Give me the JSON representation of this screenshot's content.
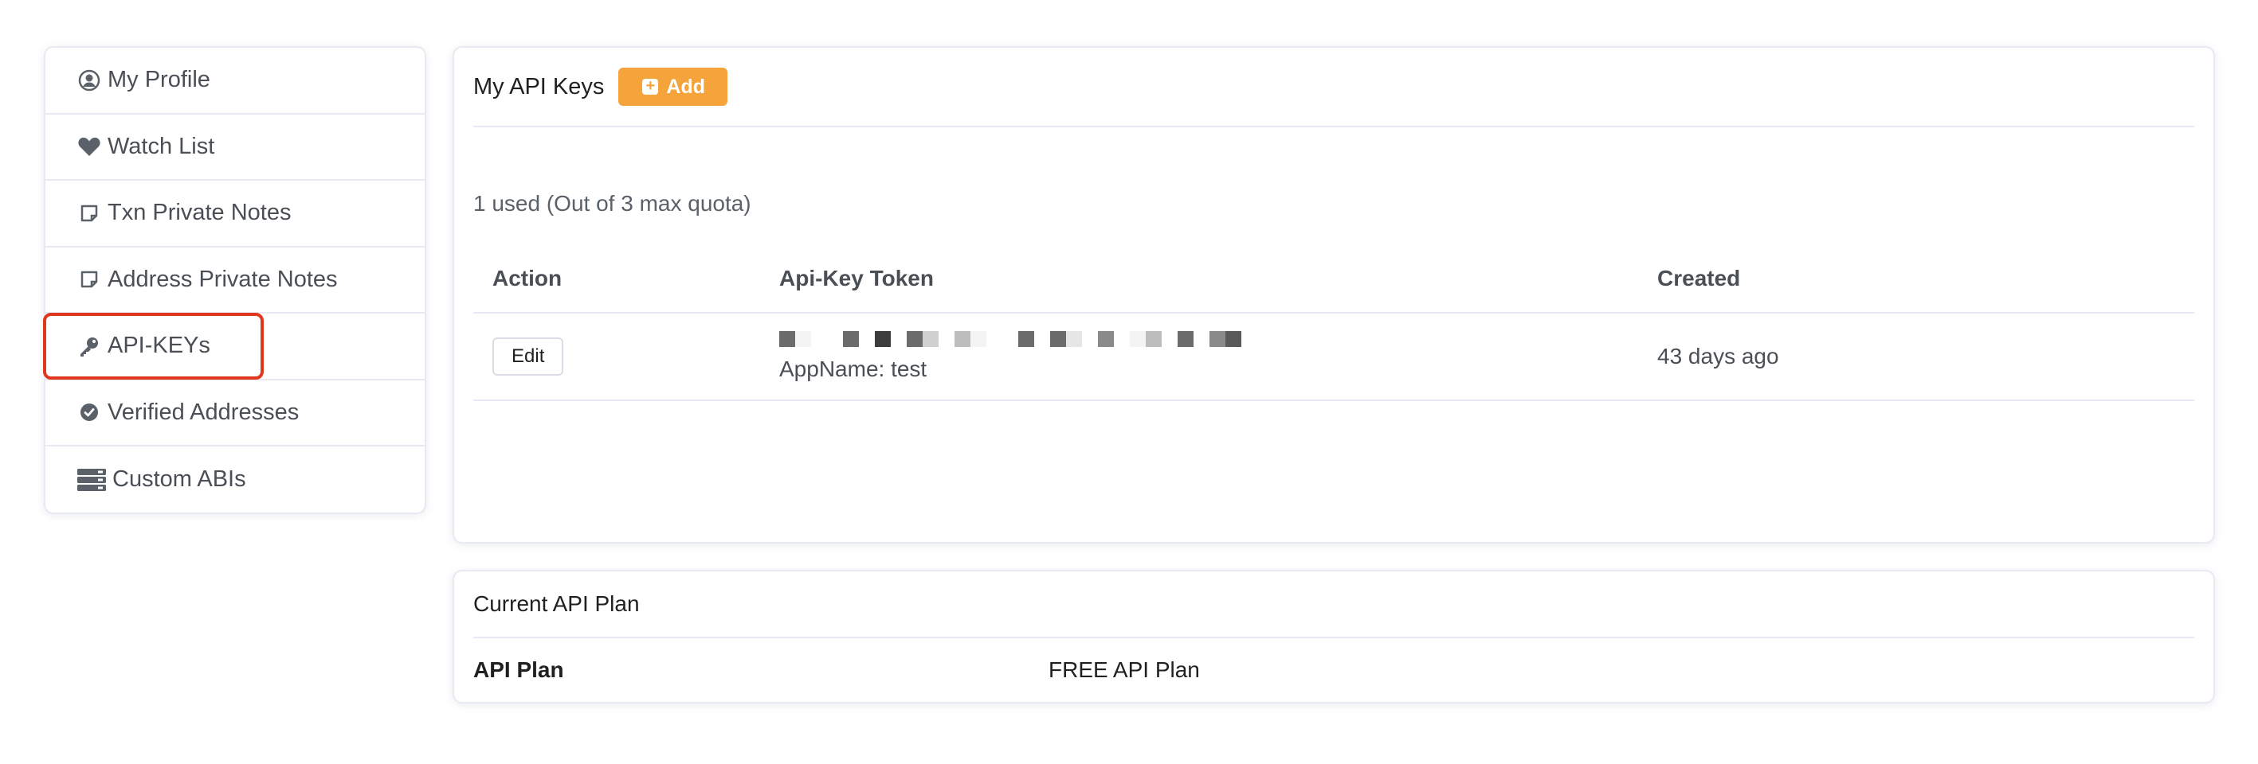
{
  "sidebar": {
    "items": [
      {
        "label": "My Profile",
        "icon": "user-circle-icon"
      },
      {
        "label": "Watch List",
        "icon": "heart-icon"
      },
      {
        "label": "Txn Private Notes",
        "icon": "sticky-note-icon"
      },
      {
        "label": "Address Private Notes",
        "icon": "sticky-note-icon"
      },
      {
        "label": "API-KEYs",
        "icon": "key-icon"
      },
      {
        "label": "Verified Addresses",
        "icon": "check-badge-icon"
      },
      {
        "label": "Custom ABIs",
        "icon": "server-icon"
      }
    ],
    "selected": "API-KEYs"
  },
  "api_keys": {
    "title": "My API Keys",
    "add_label": "Add",
    "quota": "1 used (Out of 3 max quota)",
    "columns": [
      "Action",
      "Api-Key Token",
      "Created"
    ],
    "rows": [
      {
        "action": "Edit",
        "appname": "AppName: test",
        "created": "43 days ago"
      }
    ]
  },
  "plan": {
    "title": "Current API Plan",
    "label": "API Plan",
    "value": "FREE API Plan"
  },
  "colors": {
    "accent": "#f5a33b",
    "highlight": "#e2371f",
    "border": "#e7eaf3"
  }
}
